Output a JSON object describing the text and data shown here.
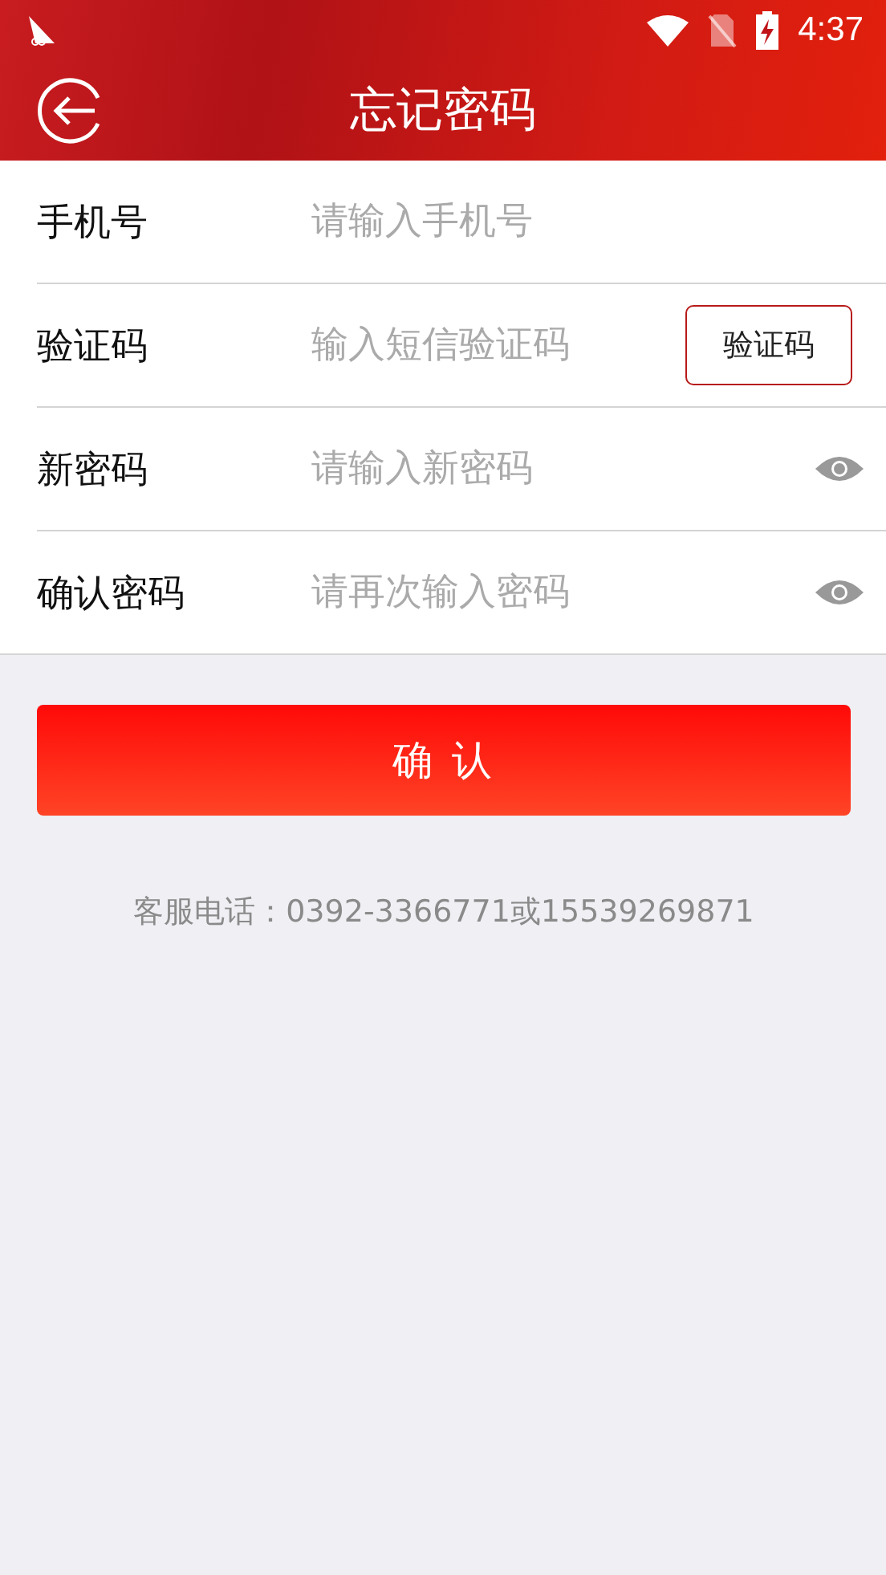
{
  "status_bar": {
    "time": "4:37"
  },
  "header": {
    "title": "忘记密码"
  },
  "fields": [
    {
      "kind": "text",
      "label": "手机号",
      "placeholder": "请输入手机号"
    },
    {
      "kind": "code",
      "label": "验证码",
      "placeholder": "输入短信验证码",
      "button": "验证码"
    },
    {
      "kind": "password",
      "label": "新密码",
      "placeholder": "请输入新密码"
    },
    {
      "kind": "password",
      "label": "确认密码",
      "placeholder": "请再次输入密码"
    }
  ],
  "confirm_button": "确 认",
  "service_phone": "客服电话：0392-3366771或15539269871"
}
